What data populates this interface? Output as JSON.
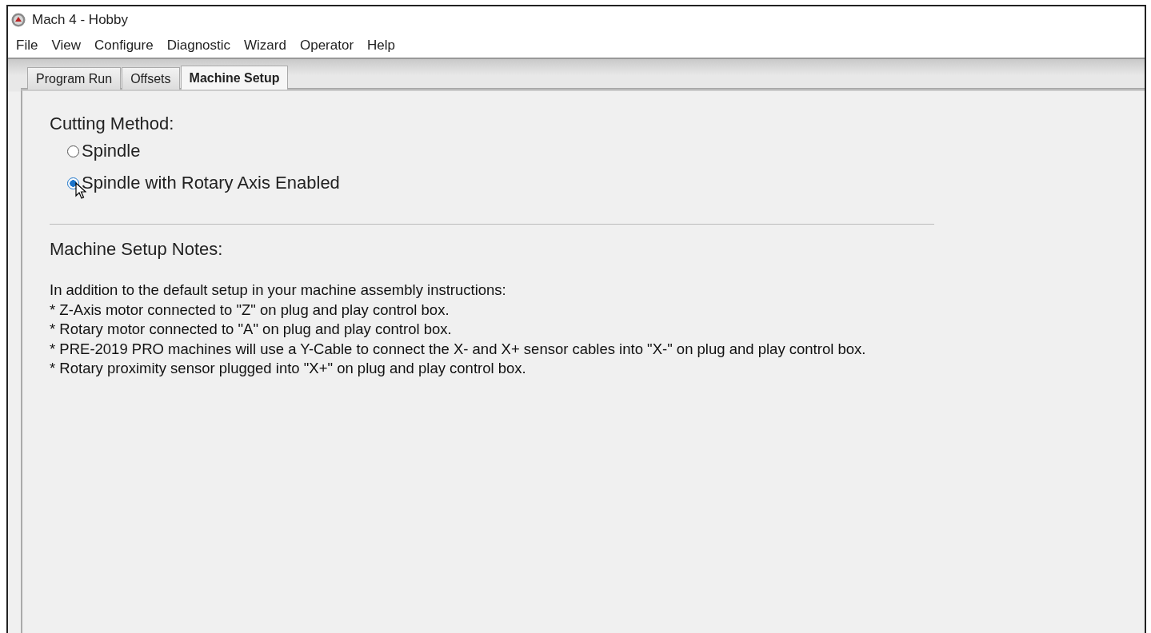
{
  "window": {
    "title": "Mach 4 - Hobby"
  },
  "menu": [
    "File",
    "View",
    "Configure",
    "Diagnostic",
    "Wizard",
    "Operator",
    "Help"
  ],
  "tabs": [
    {
      "label": "Program Run",
      "selected": false
    },
    {
      "label": "Offsets",
      "selected": false
    },
    {
      "label": "Machine Setup",
      "selected": true
    }
  ],
  "cutting_method": {
    "heading": "Cutting Method:",
    "options": [
      {
        "label": "Spindle",
        "selected": false
      },
      {
        "label": "Spindle with Rotary Axis Enabled",
        "selected": true
      }
    ]
  },
  "notes": {
    "heading": "Machine Setup Notes:",
    "lines": [
      "In addition to the default setup in your machine assembly instructions:",
      "* Z-Axis motor connected to \"Z\" on plug and play control box.",
      "* Rotary motor connected to \"A\" on plug and play control box.",
      "* PRE-2019 PRO machines will use a Y-Cable to connect the X- and X+ sensor cables into \"X-\" on plug and play control box.",
      "* Rotary proximity sensor plugged into \"X+\" on plug and play control box."
    ]
  }
}
